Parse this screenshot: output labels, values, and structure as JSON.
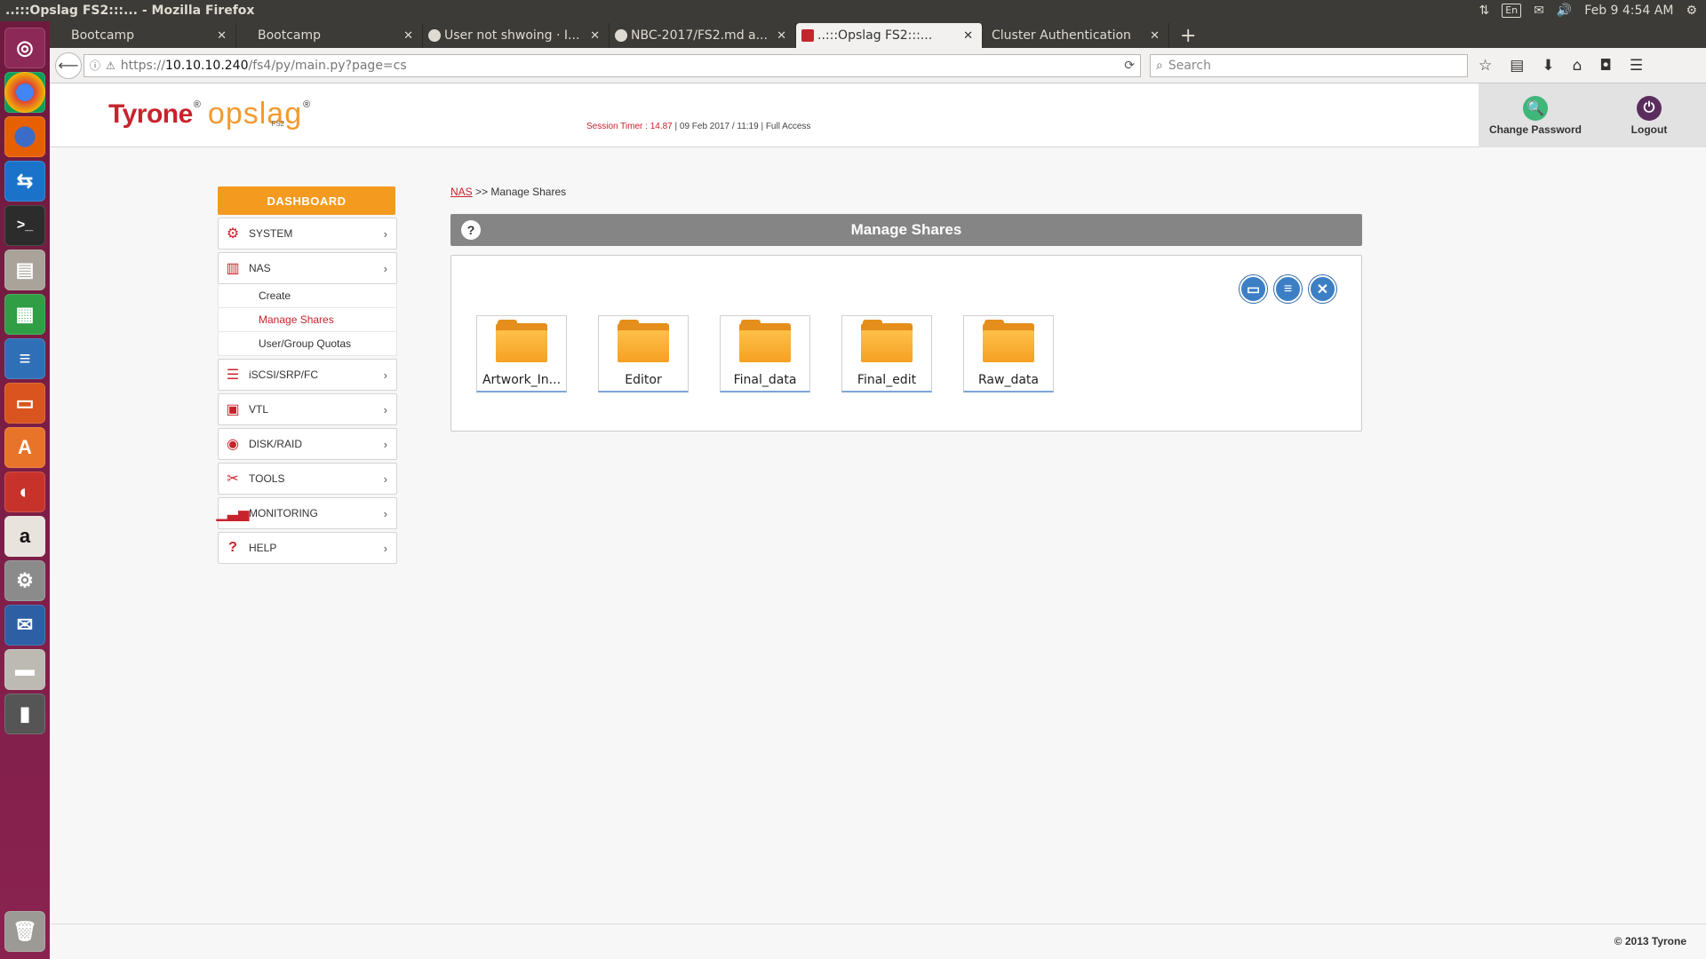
{
  "window": {
    "title": "..:::Opslag FS2:::... - Mozilla Firefox"
  },
  "top_panel": {
    "kbd_layout": "En",
    "clock": "Feb 9  4:54 AM"
  },
  "launcher": {
    "icons": [
      "ubuntu-dash-icon",
      "chrome-icon",
      "firefox-icon",
      "teamviewer-icon",
      "terminal-icon",
      "files-icon",
      "calc-icon",
      "writer-icon",
      "impress-icon",
      "software-center-icon",
      "app-icon",
      "amazon-icon",
      "settings-icon",
      "thunderbird-icon",
      "drive-icon",
      "device-icon"
    ]
  },
  "tabs": [
    {
      "label": "Bootcamp",
      "active": false
    },
    {
      "label": "Bootcamp",
      "active": false
    },
    {
      "label": "User not shwoing · I...",
      "active": false
    },
    {
      "label": "NBC-2017/FS2.md a...",
      "active": false
    },
    {
      "label": "..:::Opslag FS2:::...",
      "active": true
    },
    {
      "label": "Cluster Authentication",
      "active": false
    }
  ],
  "navbar": {
    "url_prefix": "https://",
    "url_host": "10.10.10.240",
    "url_path": "/fs4/py/main.py?page=cs",
    "search_placeholder": "Search"
  },
  "header": {
    "brand": "Tyrone",
    "product": "opslag",
    "product_sub": "FS2",
    "session_label": "Session Timer : ",
    "session_value": "14.87",
    "session_rest": " | 09 Feb 2017 / 11:19 | Full Access",
    "change_password": "Change Password",
    "logout": "Logout"
  },
  "sidebar": {
    "dashboard": "DASHBOARD",
    "items": [
      {
        "label": "SYSTEM",
        "icon": "gear-icon"
      },
      {
        "label": "NAS",
        "icon": "nas-icon"
      },
      {
        "label": "iSCSI/SRP/FC",
        "icon": "server-icon"
      },
      {
        "label": "VTL",
        "icon": "tape-icon"
      },
      {
        "label": "DISK/RAID",
        "icon": "disk-icon"
      },
      {
        "label": "TOOLS",
        "icon": "tools-icon"
      },
      {
        "label": "MONITORING",
        "icon": "chart-icon"
      },
      {
        "label": "HELP",
        "icon": "question-icon"
      }
    ],
    "nas_sub": [
      {
        "label": "Create",
        "active": false
      },
      {
        "label": "Manage Shares",
        "active": true
      },
      {
        "label": "User/Group Quotas",
        "active": false
      }
    ]
  },
  "breadcrumb": {
    "root": "NAS",
    "sep": ">>",
    "current": "Manage Shares"
  },
  "panel": {
    "title": "Manage Shares",
    "shares": [
      "Artwork_In...",
      "Editor",
      "Final_data",
      "Final_edit",
      "Raw_data"
    ]
  },
  "footer": {
    "copyright": "© 2013 Tyrone"
  },
  "colors": {
    "brand_red": "#c8232c",
    "brand_orange": "#f39a1f",
    "action_blue": "#3c7fc4"
  }
}
